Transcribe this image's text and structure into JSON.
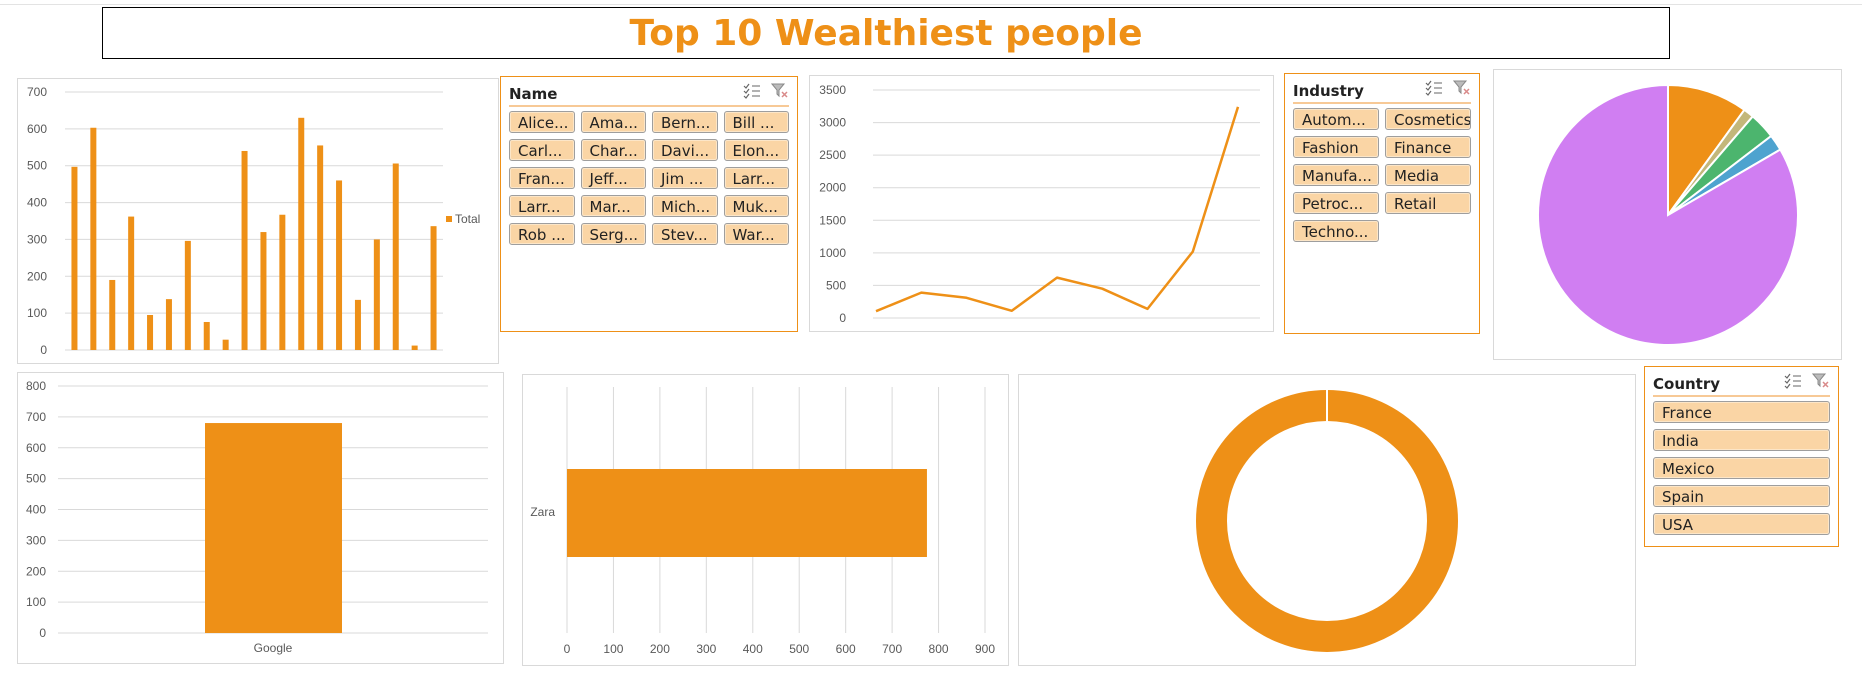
{
  "dashboard": {
    "title": "Top 10 Wealthiest people"
  },
  "slicers": {
    "name": {
      "title": "Name",
      "items": [
        "Alice...",
        "Ama...",
        "Bern...",
        "Bill ...",
        "Carl...",
        "Char...",
        "Davi...",
        "Elon...",
        "Fran...",
        "Jeff...",
        "Jim ...",
        "Larr...",
        "Larr...",
        "Mar...",
        "Mich...",
        "Muk...",
        "Rob ...",
        "Serg...",
        "Stev...",
        "War..."
      ]
    },
    "industry": {
      "title": "Industry",
      "items": [
        "Autom...",
        "Cosmetics",
        "Fashion",
        "Finance",
        "Manufa...",
        "Media",
        "Petroc...",
        "Retail",
        "Techno..."
      ]
    },
    "country": {
      "title": "Country",
      "items": [
        "France",
        "India",
        "Mexico",
        "Spain",
        "USA"
      ]
    },
    "icons": [
      "multi-select-icon",
      "clear-filter-icon"
    ]
  },
  "colors": {
    "accent": "#ee9017",
    "slicer_fill": "#fad5a5",
    "pie_purple": "#d07ef2",
    "pie_olive": "#c3b77a",
    "pie_green": "#4cb56e",
    "pie_blue": "#4ea3cf"
  },
  "chart_data": [
    {
      "type": "bar",
      "values": [
        497,
        603,
        190,
        362,
        95,
        138,
        296,
        76,
        28,
        540,
        320,
        367,
        630,
        555,
        460,
        136,
        300,
        506,
        12,
        336
      ],
      "series": [
        {
          "name": "Total"
        }
      ],
      "ylim": [
        0,
        700
      ],
      "yticks": [
        "0",
        "100",
        "200",
        "300",
        "400",
        "500",
        "600",
        "700"
      ],
      "legend": "right"
    },
    {
      "type": "line",
      "values": [
        105,
        390,
        310,
        110,
        620,
        450,
        140,
        1020,
        3240
      ],
      "ylim": [
        0,
        3500
      ],
      "yticks": [
        "0",
        "500",
        "1000",
        "1500",
        "2000",
        "2500",
        "3000",
        "3500"
      ]
    },
    {
      "type": "pie",
      "values": [
        10,
        1.3,
        3.3,
        2,
        83.4
      ],
      "colors": [
        "#ee9017",
        "#c3b77a",
        "#4cb56e",
        "#4ea3cf",
        "#d07ef2"
      ]
    },
    {
      "type": "bar",
      "categories": [
        "Google"
      ],
      "values": [
        680
      ],
      "ylim": [
        0,
        800
      ],
      "yticks": [
        "0",
        "100",
        "200",
        "300",
        "400",
        "500",
        "600",
        "700",
        "800"
      ]
    },
    {
      "type": "bar",
      "orientation": "horizontal",
      "categories": [
        "Zara"
      ],
      "values": [
        775
      ],
      "xlim": [
        0,
        900
      ],
      "xticks": [
        "0",
        "100",
        "200",
        "300",
        "400",
        "500",
        "600",
        "700",
        "800",
        "900"
      ]
    },
    {
      "type": "pie",
      "style": "doughnut",
      "values": [
        100
      ]
    }
  ]
}
